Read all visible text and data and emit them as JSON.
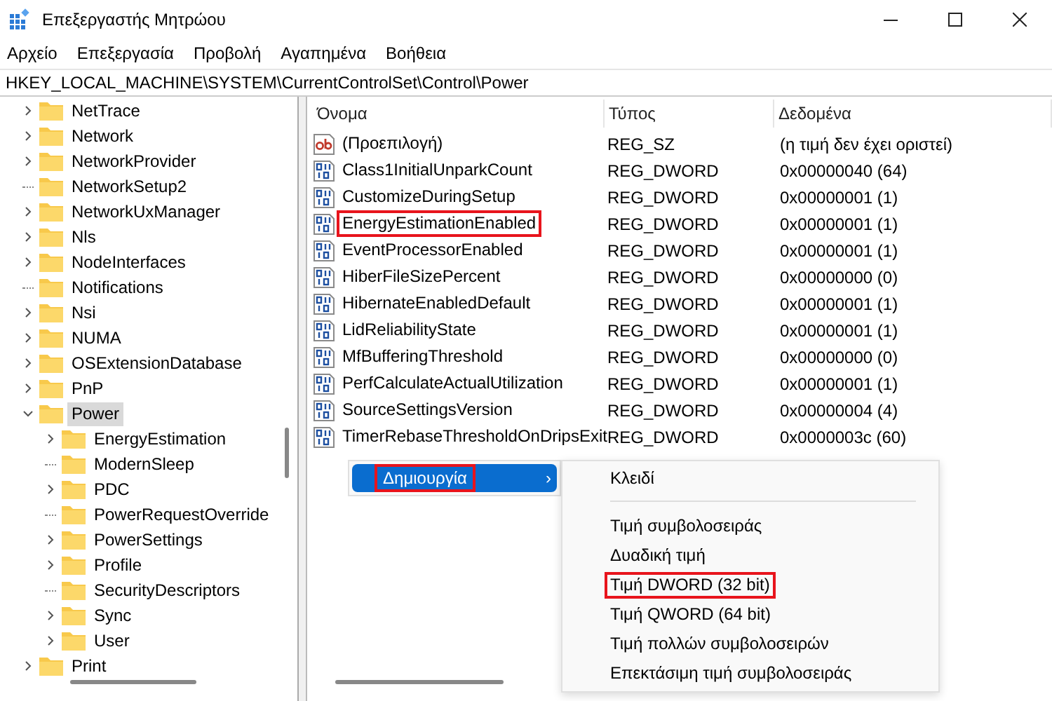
{
  "window": {
    "title": "Επεξεργαστής Μητρώου"
  },
  "menu": [
    "Αρχείο",
    "Επεξεργασία",
    "Προβολή",
    "Αγαπημένα",
    "Βοήθεια"
  ],
  "address": "HKEY_LOCAL_MACHINE\\SYSTEM\\CurrentControlSet\\Control\\Power",
  "tree": [
    {
      "label": "NetTrace",
      "expandable": true,
      "selected": false
    },
    {
      "label": "Network",
      "expandable": true,
      "selected": false
    },
    {
      "label": "NetworkProvider",
      "expandable": true,
      "selected": false
    },
    {
      "label": "NetworkSetup2",
      "expandable": false,
      "selected": false
    },
    {
      "label": "NetworkUxManager",
      "expandable": true,
      "selected": false
    },
    {
      "label": "Nls",
      "expandable": true,
      "selected": false
    },
    {
      "label": "NodeInterfaces",
      "expandable": true,
      "selected": false
    },
    {
      "label": "Notifications",
      "expandable": false,
      "selected": false
    },
    {
      "label": "Nsi",
      "expandable": true,
      "selected": false
    },
    {
      "label": "NUMA",
      "expandable": true,
      "selected": false
    },
    {
      "label": "OSExtensionDatabase",
      "expandable": true,
      "selected": false
    },
    {
      "label": "PnP",
      "expandable": true,
      "selected": false
    },
    {
      "label": "Power",
      "expandable": true,
      "expanded": true,
      "selected": true,
      "children": [
        {
          "label": "EnergyEstimation",
          "expandable": true,
          "selected": false
        },
        {
          "label": "ModernSleep",
          "expandable": false,
          "selected": false
        },
        {
          "label": "PDC",
          "expandable": true,
          "selected": false
        },
        {
          "label": "PowerRequestOverride",
          "expandable": false,
          "selected": false
        },
        {
          "label": "PowerSettings",
          "expandable": true,
          "selected": false
        },
        {
          "label": "Profile",
          "expandable": true,
          "selected": false
        },
        {
          "label": "SecurityDescriptors",
          "expandable": false,
          "selected": false
        },
        {
          "label": "Sync",
          "expandable": true,
          "selected": false
        },
        {
          "label": "User",
          "expandable": true,
          "selected": false
        }
      ]
    },
    {
      "label": "Print",
      "expandable": true,
      "selected": false
    }
  ],
  "table": {
    "columns": [
      "Όνομα",
      "Τύπος",
      "Δεδομένα"
    ],
    "rows": [
      {
        "kind": "string",
        "name": "(Προεπιλογή)",
        "type": "REG_SZ",
        "data": "(η τιμή δεν έχει οριστεί)",
        "highlighted": false
      },
      {
        "kind": "dword",
        "name": "Class1InitialUnparkCount",
        "type": "REG_DWORD",
        "data": "0x00000040 (64)",
        "highlighted": false
      },
      {
        "kind": "dword",
        "name": "CustomizeDuringSetup",
        "type": "REG_DWORD",
        "data": "0x00000001 (1)",
        "highlighted": false
      },
      {
        "kind": "dword",
        "name": "EnergyEstimationEnabled",
        "type": "REG_DWORD",
        "data": "0x00000001 (1)",
        "highlighted": true
      },
      {
        "kind": "dword",
        "name": "EventProcessorEnabled",
        "type": "REG_DWORD",
        "data": "0x00000001 (1)",
        "highlighted": false
      },
      {
        "kind": "dword",
        "name": "HiberFileSizePercent",
        "type": "REG_DWORD",
        "data": "0x00000000 (0)",
        "highlighted": false
      },
      {
        "kind": "dword",
        "name": "HibernateEnabledDefault",
        "type": "REG_DWORD",
        "data": "0x00000001 (1)",
        "highlighted": false
      },
      {
        "kind": "dword",
        "name": "LidReliabilityState",
        "type": "REG_DWORD",
        "data": "0x00000001 (1)",
        "highlighted": false
      },
      {
        "kind": "dword",
        "name": "MfBufferingThreshold",
        "type": "REG_DWORD",
        "data": "0x00000000 (0)",
        "highlighted": false
      },
      {
        "kind": "dword",
        "name": "PerfCalculateActualUtilization",
        "type": "REG_DWORD",
        "data": "0x00000001 (1)",
        "highlighted": false
      },
      {
        "kind": "dword",
        "name": "SourceSettingsVersion",
        "type": "REG_DWORD",
        "data": "0x00000004 (4)",
        "highlighted": false
      },
      {
        "kind": "dword",
        "name": "TimerRebaseThresholdOnDripsExit",
        "type": "REG_DWORD",
        "data": "0x0000003c (60)",
        "highlighted": false
      }
    ]
  },
  "context_menu": {
    "items": [
      {
        "label": "Δημιουργία",
        "arrow": "›",
        "selected": true,
        "highlighted": true
      }
    ]
  },
  "submenu": {
    "items": [
      {
        "label": "Κλειδί",
        "separator_after": true,
        "highlighted": false
      },
      {
        "label": "Τιμή συμβολοσειράς",
        "separator_after": false,
        "highlighted": false
      },
      {
        "label": "Δυαδική τιμή",
        "separator_after": false,
        "highlighted": false
      },
      {
        "label": "Τιμή DWORD (32 bit)",
        "separator_after": false,
        "highlighted": true
      },
      {
        "label": "Τιμή QWORD (64 bit)",
        "separator_after": false,
        "highlighted": false
      },
      {
        "label": "Τιμή πολλών συμβολοσειρών",
        "separator_after": false,
        "highlighted": false
      },
      {
        "label": "Επεκτάσιμη τιμή συμβολοσειράς",
        "separator_after": false,
        "highlighted": false
      }
    ]
  }
}
